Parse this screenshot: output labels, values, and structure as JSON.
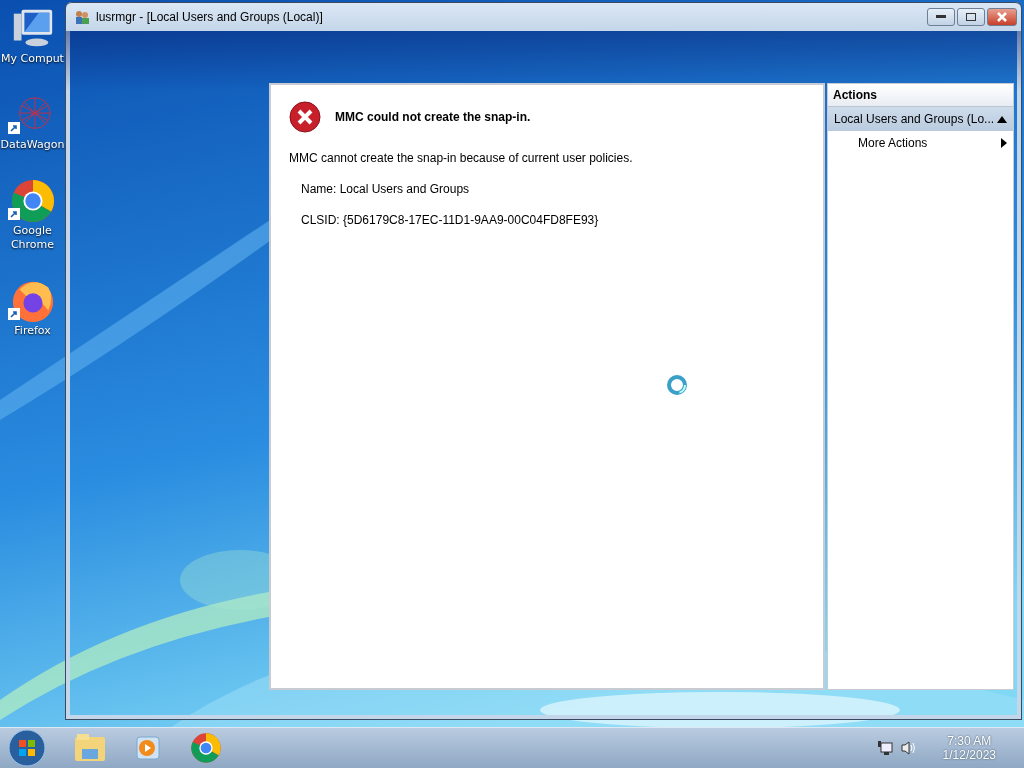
{
  "desktop_icons": [
    {
      "kind": "computer",
      "label": "My Comput",
      "shortcut": false
    },
    {
      "kind": "network",
      "label": "DataWagon",
      "shortcut": true
    },
    {
      "kind": "chrome",
      "label": "Google Chrome",
      "shortcut": true
    },
    {
      "kind": "firefox",
      "label": "Firefox",
      "shortcut": true
    }
  ],
  "window": {
    "title": "lusrmgr - [Local Users and Groups (Local)]"
  },
  "error": {
    "heading": "MMC could not create the snap-in.",
    "message": "MMC cannot create the snap-in because of current user policies.",
    "details": [
      "Name: Local Users and Groups",
      "CLSID: {5D6179C8-17EC-11D1-9AA9-00C04FD8FE93}"
    ]
  },
  "actions": {
    "header": "Actions",
    "section": {
      "label": "Local Users and Groups (Lo...",
      "expanded": true
    },
    "items": [
      {
        "label": "More Actions"
      }
    ]
  },
  "taskbar": {
    "apps": [
      {
        "kind": "explorer"
      },
      {
        "kind": "media-player"
      },
      {
        "kind": "chrome"
      }
    ],
    "time": "7:30 AM",
    "date": "1/12/2023"
  }
}
